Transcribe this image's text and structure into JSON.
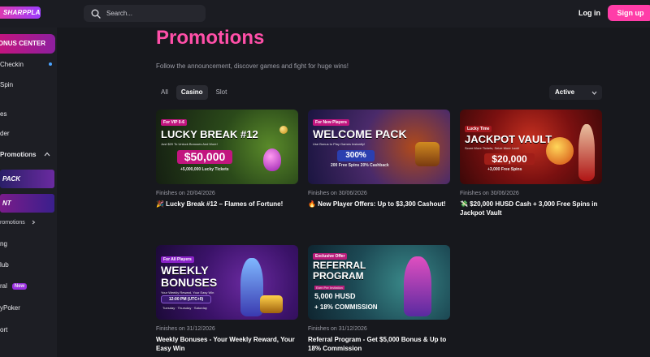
{
  "header": {
    "logo_text": "SHARPPLAY",
    "search_placeholder": "Search...",
    "login_label": "Log in",
    "signup_label": "Sign up"
  },
  "sidebar": {
    "bonus_center": "BONUS CENTER",
    "checkin": "Checkin",
    "spin": "Spin",
    "item_es": "es",
    "item_der": "der",
    "promotions": "Promotions",
    "banner_a": "PACK",
    "banner_b": "NT",
    "all_promotions": "romotions",
    "item_ng": "ng",
    "item_club": "lub",
    "item_referral": "ral",
    "new_badge": "New",
    "item_poker": "yPoker",
    "item_sport": "ort"
  },
  "page": {
    "title": "Promotions",
    "subtitle": "Follow the announcement, discover games and fight for huge wins!",
    "tabs": [
      "All",
      "Casino",
      "Slot"
    ],
    "active_tab": "Casino",
    "status_filter": "Active"
  },
  "cards": [
    {
      "date": "Finishes on 20/04/2026",
      "title": "🎉 Lucky Break #12 – Flames of Fortune!",
      "img_tag": "For VIP 0-6",
      "img_title": "LUCKY BREAK #12",
      "img_sub": "Just $20 To Unlock Bonuses And More!",
      "img_value": "$50,000",
      "img_extra": "+5,000,000 Lucky Tickets"
    },
    {
      "date": "Finishes on 30/06/2026",
      "title": "🔥 New Player Offers: Up to $3,300 Cashout!",
      "img_tag": "For New Players",
      "img_title": "WELCOME PACK",
      "img_sub": "Use Bonus to Play Games Instantly!",
      "img_value": "300%",
      "img_extra": "200 Free Spins  20% Cashback"
    },
    {
      "date": "Finishes on 30/06/2026",
      "title": "💸 $20,000 HUSD Cash + 3,000 Free Spins in Jackpot Vault",
      "img_tag": "Lucky Time",
      "img_title": "JACKPOT VAULT",
      "img_sub": "Score More Tickets, Seize More Luck!",
      "img_value": "$20,000",
      "img_extra": "+3,000 Free Spins"
    },
    {
      "date": "Finishes on 31/12/2026",
      "title": "Weekly Bonuses - Your Weekly Reward, Your Easy Win",
      "img_tag": "For All Players",
      "img_title": "WEEKLY BONUSES",
      "img_sub": "Your Weekly Reward, Your Easy Win",
      "img_value": "12:00 PM (UTC+0)",
      "img_extra": "Tuesday · Thursday · Saturday"
    },
    {
      "date": "Finishes on 31/12/2026",
      "title": "Referral Program - Get $5,000 Bonus & Up to 18% Commission",
      "img_tag": "Exclusive Offer",
      "img_title": "REFERRAL PROGRAM",
      "img_sub": "Earn Per Invitation",
      "img_value": "5,000 HUSD",
      "img_extra": "+ 18% COMMISSION"
    }
  ],
  "colors": {
    "accent": "#ff3da8",
    "title_pink": "#ff4fa8",
    "background": "#17181d",
    "sidebar": "#1d1e24",
    "checkin_dot": "#4aa3ff"
  },
  "icons": [
    "search-icon",
    "chevron-up-icon",
    "chevron-right-icon",
    "chevron-down-icon"
  ]
}
